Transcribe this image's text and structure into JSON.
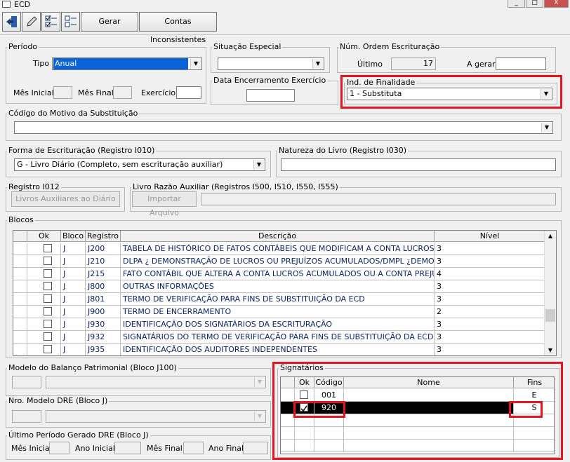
{
  "window": {
    "title": "ECD",
    "minimize": "_",
    "maximize": "□",
    "close": "X"
  },
  "toolbar": {
    "gerar_label": "Gerar",
    "contas_label": "Contas Inconsistentes"
  },
  "periodo": {
    "legend": "Período",
    "tipo_label": "Tipo",
    "tipo_value": "Anual",
    "mes_inicial_label": "Mês Inicial",
    "mes_inicial_value": "",
    "mes_final_label": "Mês Final",
    "mes_final_value": "",
    "exercicio_label": "Exercício",
    "exercicio_value": ""
  },
  "situacao": {
    "legend": "Situação Especial",
    "value": ""
  },
  "data_enc": {
    "legend": "Data Encerramento Exercício",
    "value": ""
  },
  "num_ordem": {
    "legend": "Núm. Ordem Escrituração",
    "ultimo_label": "Último",
    "ultimo_value": "17",
    "agerar_label": "A gerar",
    "agerar_value": ""
  },
  "ind_finalidade": {
    "legend": "Ind. de Finalidade",
    "value": "1 - Substituta"
  },
  "codigo_motivo": {
    "legend": "Código do Motivo da Substituição",
    "value": ""
  },
  "forma_escrit": {
    "legend": "Forma de Escrituração (Registro I010)",
    "value": "G - Livro Diário (Completo, sem escrituração auxiliar)"
  },
  "natureza": {
    "legend": "Natureza do Livro (Registro I030)",
    "value": ""
  },
  "registro_i012": {
    "legend": "Registro I012",
    "button": "Livros Auxiliares ao Diário"
  },
  "livro_razao": {
    "legend": "Livro Razão Auxiliar (Registros I500, I510, I550, I555)",
    "button": "Importar Arquivo",
    "path": ""
  },
  "blocos": {
    "legend": "Blocos",
    "columns": [
      "Ok",
      "Bloco",
      "Registro",
      "Descrição",
      "Nível"
    ],
    "rows": [
      {
        "bloco": "J",
        "registro": "J200",
        "descricao": "TABELA DE HISTÓRICO DE FATOS CONTÁBEIS QUE MODIFICAM A CONTA LUCROS ACUMULADOS",
        "nivel": "3"
      },
      {
        "bloco": "J",
        "registro": "J210",
        "descricao": "DLPA ¿ DEMONSTRAÇÃO DE LUCROS OU PREJUÍZOS ACUMULADOS/DMPL ¿DEMONSTRAÇÃO",
        "nivel": "3"
      },
      {
        "bloco": "J",
        "registro": "J215",
        "descricao": "FATO CONTÁBIL QUE ALTERA A CONTA LUCROS ACUMULADOS OU A CONTA PREJUÍZOS",
        "nivel": "4"
      },
      {
        "bloco": "J",
        "registro": "J800",
        "descricao": "OUTRAS INFORMAÇÕES",
        "nivel": "3"
      },
      {
        "bloco": "J",
        "registro": "J801",
        "descricao": "TERMO DE VERIFICAÇÃO PARA FINS DE SUBSTITUIÇÃO DA ECD",
        "nivel": "3"
      },
      {
        "bloco": "J",
        "registro": "J900",
        "descricao": "TERMO DE ENCERRAMENTO",
        "nivel": "2"
      },
      {
        "bloco": "J",
        "registro": "J930",
        "descricao": "IDENTIFICAÇÃO DOS SIGNATÁRIOS DA ESCRITURAÇÃO",
        "nivel": "3"
      },
      {
        "bloco": "J",
        "registro": "J932",
        "descricao": "SIGNATÁRIOS DO TERMO DE VERIFICAÇÃO PARA FINS DE SUBSTITUIÇÃO DA ECD",
        "nivel": "3"
      },
      {
        "bloco": "J",
        "registro": "J935",
        "descricao": "IDENTIFICAÇÃO DOS AUDITORES INDEPENDENTES",
        "nivel": "3"
      }
    ]
  },
  "modelo_balanco": {
    "legend": "Modelo do Balanço Patrimonial (Bloco J100)"
  },
  "modelo_dre": {
    "legend": "Nro. Modelo DRE (Bloco J)"
  },
  "ultimo_periodo": {
    "legend": "Último Período Gerado DRE (Bloco J)",
    "mes_inicial_label": "Mês Inicial",
    "ano_inicial_label": "Ano Inicial",
    "mes_final_label": "Mês Final",
    "ano_final_label": "Ano Final"
  },
  "signatarios": {
    "legend": "Signatários",
    "columns": [
      "Ok",
      "Código",
      "Nome",
      "Fins"
    ],
    "rows": [
      {
        "ok": false,
        "codigo": "001",
        "nome": "",
        "fins": "E"
      },
      {
        "ok": true,
        "codigo": "920",
        "nome": "",
        "fins": "S"
      }
    ]
  },
  "colors": {
    "highlight": "#e8141e",
    "selected_row": "#000000"
  }
}
